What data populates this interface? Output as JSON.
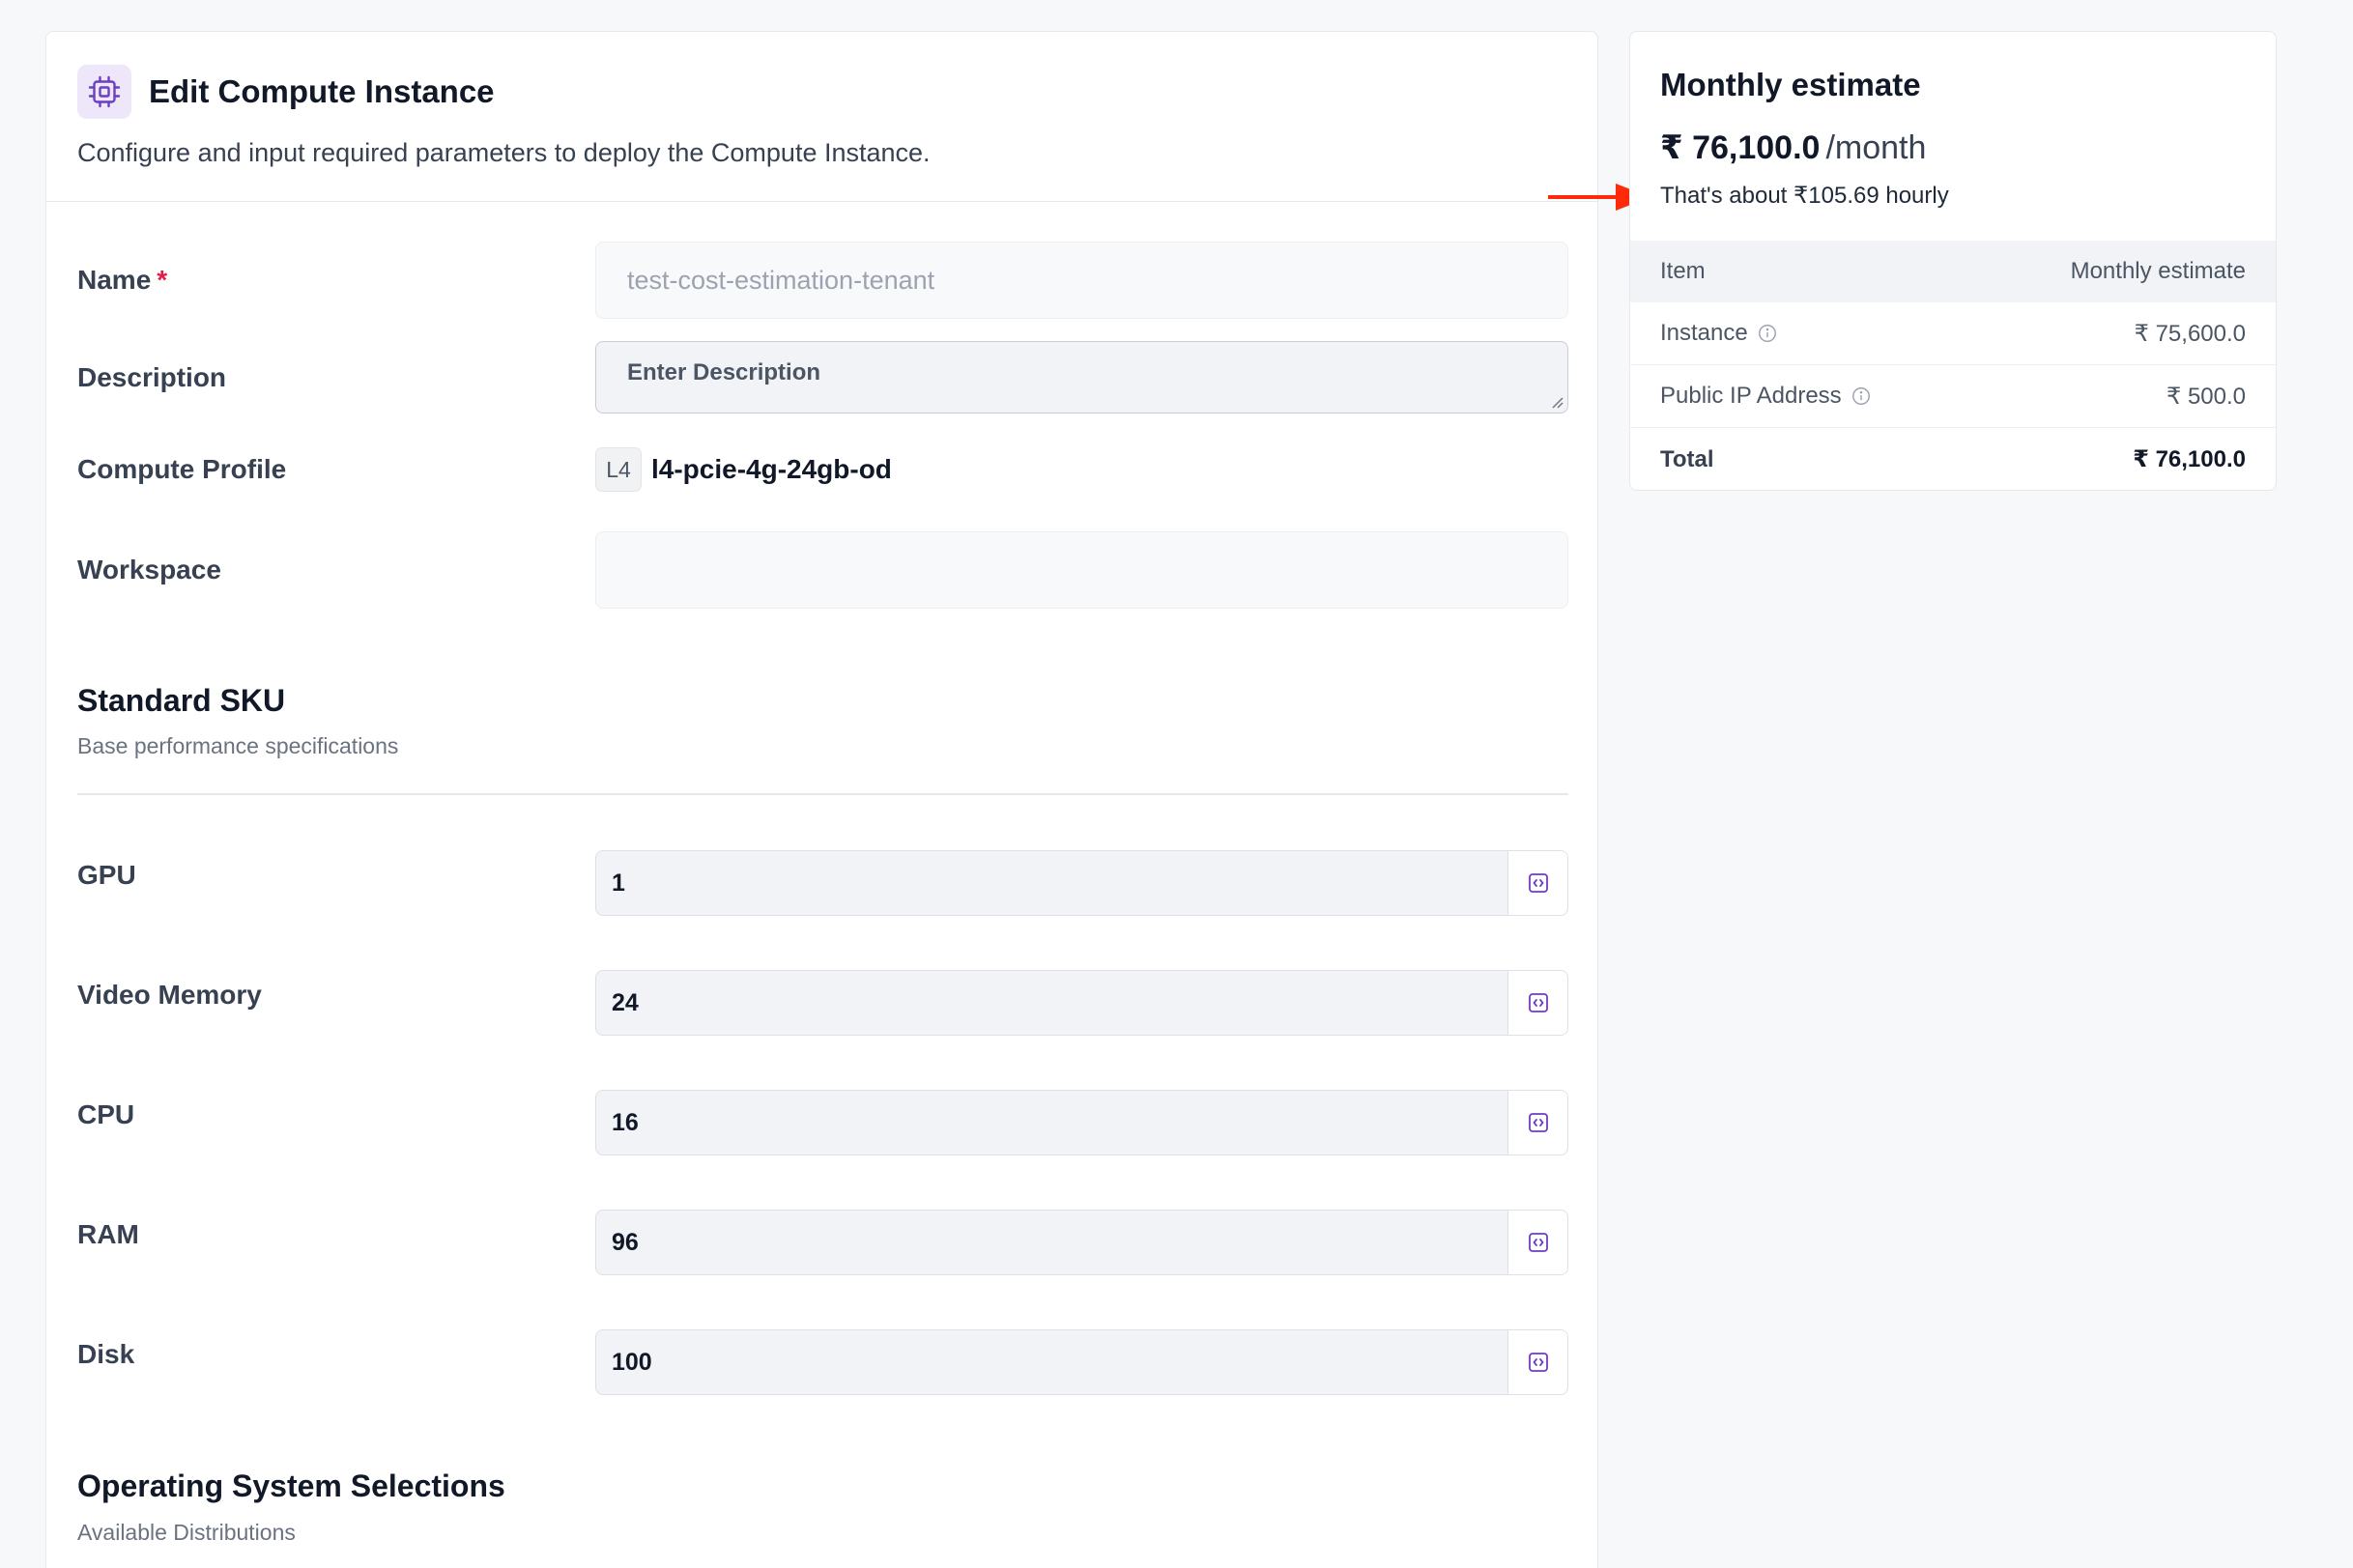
{
  "form": {
    "title": "Edit Compute Instance",
    "subtitle": "Configure and input required parameters to deploy the Compute Instance.",
    "name": {
      "label": "Name",
      "required_mark": "*",
      "value": "test-cost-estimation-tenant"
    },
    "description": {
      "label": "Description",
      "placeholder": "Enter Description"
    },
    "compute_profile": {
      "label": "Compute Profile",
      "chip": "L4",
      "value": "l4-pcie-4g-24gb-od"
    },
    "workspace": {
      "label": "Workspace",
      "value": ""
    },
    "standard_sku": {
      "title": "Standard SKU",
      "subtitle": "Base performance specifications",
      "fields": [
        {
          "label": "GPU",
          "value": "1"
        },
        {
          "label": "Video Memory",
          "value": "24"
        },
        {
          "label": "CPU",
          "value": "16"
        },
        {
          "label": "RAM",
          "value": "96"
        },
        {
          "label": "Disk",
          "value": "100"
        }
      ]
    },
    "os_section": {
      "title": "Operating System Selections",
      "subtitle": "Available Distributions"
    }
  },
  "estimate": {
    "title": "Monthly estimate",
    "amount": "₹ 76,100.0",
    "period": "/month",
    "hourly": "That's about ₹105.69 hourly",
    "table": {
      "col_item": "Item",
      "col_estimate": "Monthly estimate",
      "rows": [
        {
          "item": "Instance",
          "value": "₹ 75,600.0"
        },
        {
          "item": "Public IP Address",
          "value": "₹ 500.0"
        }
      ],
      "total_label": "Total",
      "total_value": "₹ 76,100.0"
    }
  },
  "colors": {
    "accent": "#6d3fc0",
    "annotation_arrow": "#ff2a0a",
    "required": "#e11d48"
  }
}
